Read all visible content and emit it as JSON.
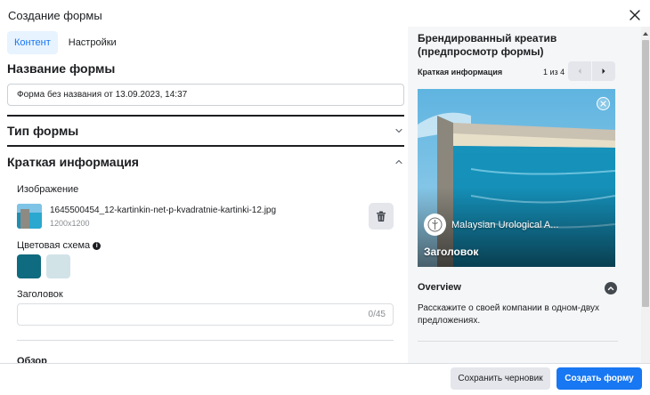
{
  "dialog": {
    "title": "Создание формы"
  },
  "tabs": [
    {
      "label": "Контент",
      "active": true
    },
    {
      "label": "Настройки",
      "active": false
    }
  ],
  "form_name": {
    "heading": "Название формы",
    "value": "Форма без названия от 13.09.2023, 14:37"
  },
  "form_type": {
    "heading": "Тип формы"
  },
  "intro": {
    "heading": "Краткая информация",
    "image_label": "Изображение",
    "file_name": "1645500454_12-kartinkin-net-p-kvadratnie-kartinki-12.jpg",
    "file_size": "1200x1200",
    "color_label": "Цветовая схема",
    "info_glyph": "i",
    "colors": [
      "#0f6b7f",
      "#d2e3e8"
    ],
    "headline_label": "Заголовок",
    "headline_value": "",
    "headline_count": "0/45",
    "next_section": "Обзор"
  },
  "preview": {
    "title": "Брендированный креатив (предпросмотр формы)",
    "subtitle": "Краткая информация",
    "page_count": "1 из 4",
    "brand_name": "Malaysian Urological A...",
    "headline": "Заголовок",
    "overview_title": "Overview",
    "overview_text": "Расскажите о своей компании в одном-двух предложениях."
  },
  "footer": {
    "draft_label": "Сохранить черновик",
    "create_label": "Создать форму"
  },
  "colors": {
    "accent": "#1877f2",
    "text": "#1c1e21",
    "secondary": "#8a8d91"
  },
  "icons": [
    "close-icon",
    "chevron-down-icon",
    "chevron-up-icon",
    "trash-icon",
    "info-icon",
    "chevron-left-icon",
    "chevron-right-icon",
    "brand-logo-icon"
  ]
}
